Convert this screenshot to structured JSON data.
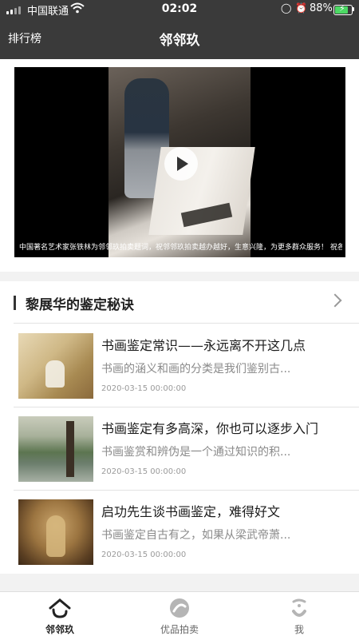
{
  "status_bar": {
    "carrier": "中国联通",
    "time": "02:02",
    "battery": "88%",
    "battery_level": 0.88,
    "icons": [
      "signal-icon",
      "wifi-icon",
      "orientation-lock-icon",
      "alarm-icon",
      "battery-charging-icon"
    ]
  },
  "nav": {
    "title": "邻邻玖",
    "left_label": "排行榜"
  },
  "video": {
    "caption": "中国著名艺术家张铁林为邻邻玖拍卖题词，祝邻邻玖拍卖越办越好，生意兴隆，为更多群众服务！ 祝各位会员身"
  },
  "section": {
    "title": "黎展华的鉴定秘诀"
  },
  "articles": [
    {
      "title": "书画鉴定常识——永远离不开这几点",
      "desc": "书画的涵义和画的分类是我们鉴别古...",
      "date": "2020-03-15 00:00:00"
    },
    {
      "title": "书画鉴定有多高深，你也可以逐步入门",
      "desc": "书画鉴赏和辨伪是一个通过知识的积...",
      "date": "2020-03-15 00:00:00"
    },
    {
      "title": "启功先生谈书画鉴定，难得好文",
      "desc": "书画鉴定自古有之，如果从梁武帝萧...",
      "date": "2020-03-15 00:00:00"
    }
  ],
  "tabbar": {
    "tabs": [
      {
        "label": "邻邻玖",
        "icon": "home-logo-icon",
        "active": true
      },
      {
        "label": "优品拍卖",
        "icon": "auction-icon",
        "active": false
      },
      {
        "label": "我",
        "icon": "profile-icon",
        "active": false
      }
    ]
  },
  "colors": {
    "nav_bg": "#3a3a3a",
    "battery": "#4cd964",
    "section_bg": "#f2f2f2"
  }
}
